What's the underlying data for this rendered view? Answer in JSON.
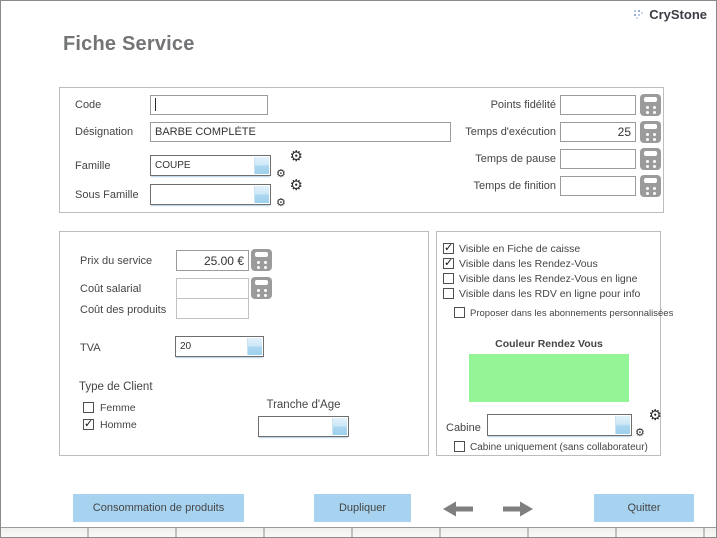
{
  "brand": {
    "name": "CryStone"
  },
  "page": {
    "title": "Fiche Service"
  },
  "identity": {
    "code_label": "Code",
    "code_value": "",
    "designation_label": "Désignation",
    "designation_value": "BARBE COMPLÈTE",
    "famille_label": "Famille",
    "famille_value": "COUPE",
    "sous_famille_label": "Sous Famille",
    "sous_famille_value": ""
  },
  "timing": {
    "points_label": "Points fidélité",
    "points_value": "",
    "execution_label": "Temps d'exécution",
    "execution_value": "25",
    "pause_label": "Temps de pause",
    "pause_value": "",
    "finition_label": "Temps de finition",
    "finition_value": ""
  },
  "pricing": {
    "prix_label": "Prix du service",
    "prix_value": "25.00 €",
    "cout_salarial_label": "Coût salarial",
    "cout_salarial_value": "",
    "cout_produits_label": "Coût des produits",
    "cout_produits_value": "",
    "tva_label": "TVA",
    "tva_value": "20",
    "type_client_label": "Type de Client",
    "femme": {
      "label": "Femme",
      "checked": false
    },
    "homme": {
      "label": "Homme",
      "checked": true
    },
    "tranche_age_label": "Tranche d'Age",
    "tranche_age_value": ""
  },
  "visibility": {
    "options": [
      {
        "label": "Visible en Fiche de caisse",
        "checked": true
      },
      {
        "label": "Visible dans les Rendez-Vous",
        "checked": true
      },
      {
        "label": "Visible dans les Rendez-Vous en ligne",
        "checked": false
      },
      {
        "label": "Visible dans les RDV en ligne pour info",
        "checked": false
      }
    ],
    "proposer": {
      "label": "Proposer dans les abonnements personnalisées",
      "checked": false
    },
    "couleur_label": "Couleur Rendez Vous",
    "couleur_value": "#93f596",
    "cabine_label": "Cabine",
    "cabine_value": "",
    "cabine_uniquement": {
      "label": "Cabine uniquement (sans collaborateur)",
      "checked": false
    }
  },
  "actions": {
    "consommation": "Consommation de produits",
    "dupliquer": "Dupliquer",
    "quitter": "Quitter"
  },
  "colors": {
    "accent_blue": "#a7d3f0",
    "appointment_green": "#93f596"
  }
}
